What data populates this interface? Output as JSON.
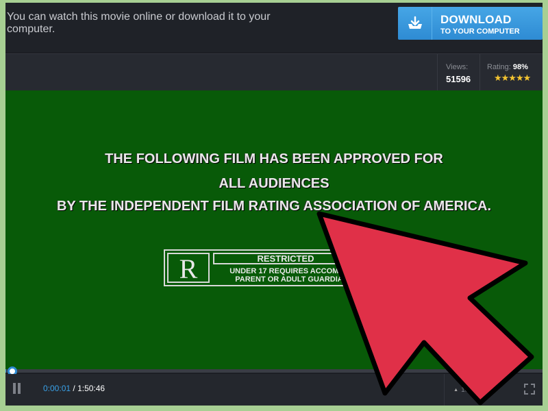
{
  "topbar": {
    "message": "You can watch this movie online or download it to your computer.",
    "download_title": "DOWNLOAD",
    "download_subtitle": "TO YOUR COMPUTER",
    "download_icon": "download-tray-icon"
  },
  "stats": {
    "views_label": "Views:",
    "views_value": "51596",
    "rating_label": "Rating:",
    "rating_value": "98%",
    "stars": "★★★★★"
  },
  "video": {
    "line1": "THE FOLLOWING FILM HAS BEEN APPROVED FOR",
    "line2": "ALL AUDIENCES",
    "line3": "BY THE INDEPENDENT FILM RATING ASSOCIATION OF AMERICA.",
    "rating_letter": "R",
    "rating_heading": "RESTRICTED",
    "rating_sub1": "UNDER 17 REQUIRES ACCOMPA",
    "rating_sub2": "PARENT OR ADULT GUARDIA",
    "background_color": "#085a08"
  },
  "player": {
    "current_time": "0:00:01",
    "separator": " / ",
    "total_time": "1:50:46",
    "quality": "1080p",
    "progress_fraction": 0.001,
    "pause_icon": "pause-icon",
    "fullscreen_icon": "fullscreen-icon"
  },
  "overlay": {
    "pointer_icon": "red-arrow-cursor-icon",
    "pointer_color": "#e03048"
  }
}
